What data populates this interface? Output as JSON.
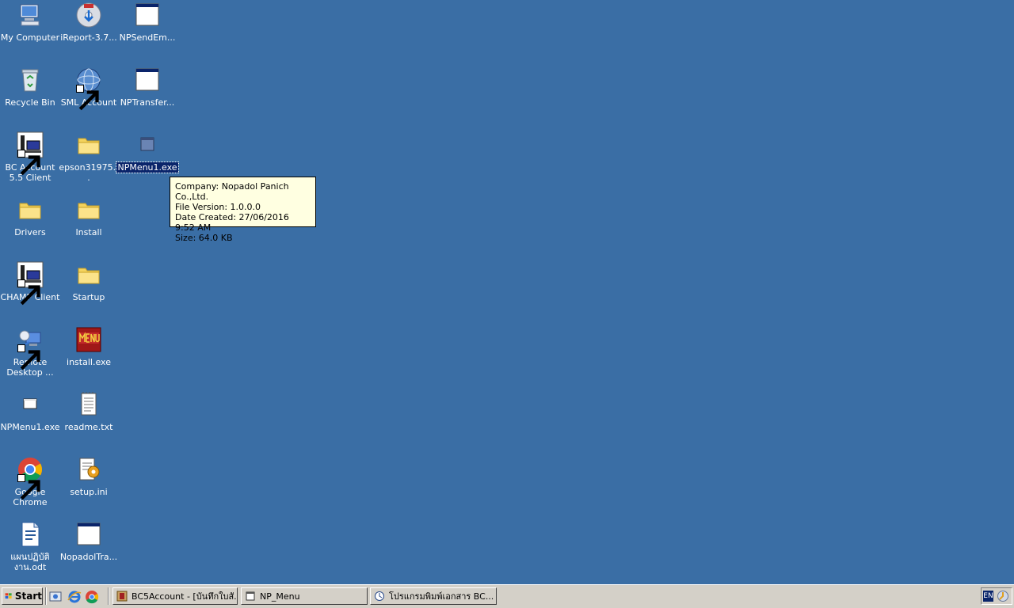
{
  "desktop": {
    "icons": [
      {
        "label": "My Computer"
      },
      {
        "label": "iReport-3.7..."
      },
      {
        "label": "NPSendEm..."
      },
      {
        "label": "Recycle Bin"
      },
      {
        "label": "SML Account"
      },
      {
        "label": "NPTransfer..."
      },
      {
        "label": "BC Account 5.5 Client"
      },
      {
        "label": "epson31975..."
      },
      {
        "label": "NPMenu1.exe"
      },
      {
        "label": "Drivers"
      },
      {
        "label": "Install"
      },
      {
        "label": "CHAMP Client"
      },
      {
        "label": "Startup"
      },
      {
        "label": "Remote Desktop ..."
      },
      {
        "label": "install.exe"
      },
      {
        "label": "NPMenu1.exe"
      },
      {
        "label": "readme.txt"
      },
      {
        "label": "Google Chrome"
      },
      {
        "label": "setup.ini"
      },
      {
        "label": "แผนปฏิบัติงาน.odt"
      },
      {
        "label": "NopadolTra..."
      }
    ]
  },
  "tooltip": {
    "company": "Company: Nopadol Panich Co.,Ltd.",
    "file_version": "File Version: 1.0.0.0",
    "date_created": "Date Created: 27/06/2016 9:52 AM",
    "size": "Size: 64.0 KB"
  },
  "taskbar": {
    "start_label": "Start",
    "tasks": [
      {
        "label": "BC5Account - [บันทึกใบสั..."
      },
      {
        "label": "NP_Menu"
      },
      {
        "label": "โปรแกรมพิมพ์เอกสาร BC..."
      }
    ],
    "language": "EN"
  },
  "colors": {
    "desktop_bg": "#3a6ea5",
    "taskbar_bg": "#d4d0c8",
    "tooltip_bg": "#ffffe1",
    "selection": "#0a246a"
  }
}
